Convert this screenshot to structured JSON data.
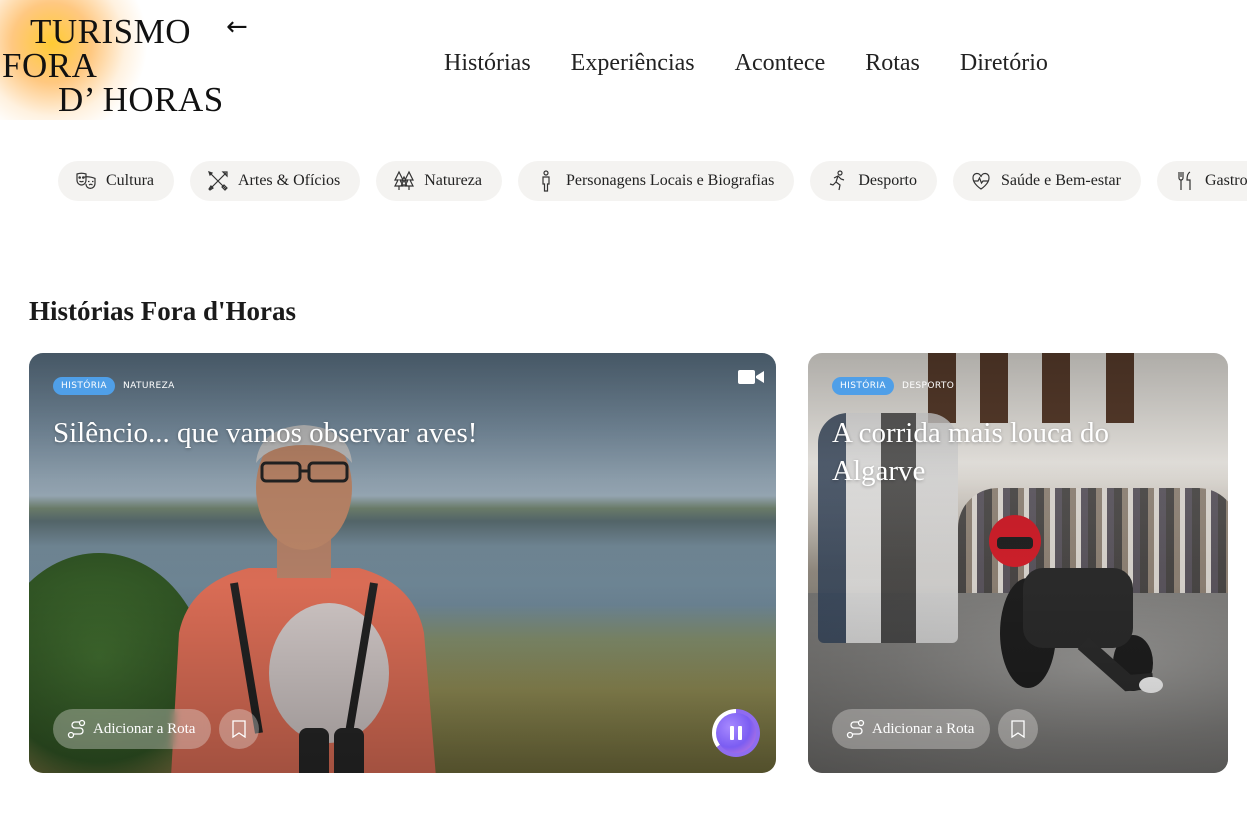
{
  "logo": {
    "line1": "TURISMO",
    "line2": "FORA",
    "line3": "D’ HORAS",
    "back_glyph": "←"
  },
  "nav": {
    "items": [
      "Histórias",
      "Experiências",
      "Acontece",
      "Rotas",
      "Diretório"
    ]
  },
  "categories": [
    {
      "label": "Cultura",
      "icon": "theatre-masks-icon"
    },
    {
      "label": "Artes & Ofícios",
      "icon": "crossed-tools-icon"
    },
    {
      "label": "Natureza",
      "icon": "trees-icon"
    },
    {
      "label": "Personagens Locais e Biografias",
      "icon": "person-icon"
    },
    {
      "label": "Desporto",
      "icon": "runner-icon"
    },
    {
      "label": "Saúde e Bem-estar",
      "icon": "heart-pulse-icon"
    },
    {
      "label": "Gastronomia",
      "icon": "fork-knife-icon"
    }
  ],
  "section": {
    "title": "Histórias Fora d'Horas"
  },
  "cards": [
    {
      "tag_main": "HISTÓRIA",
      "tag_secondary": "NATUREZA",
      "title": "Silêncio... que vamos observar aves!",
      "route_label": "Adicionar a Rota",
      "media": "video"
    },
    {
      "tag_main": "HISTÓRIA",
      "tag_secondary": "DESPORTO",
      "title": "A corrida mais louca do Algarve",
      "route_label": "Adicionar a Rota"
    }
  ],
  "colors": {
    "tag": "#4f9fe8",
    "chip_bg": "#f4f3f1",
    "player_accent": "#7b5df2"
  }
}
